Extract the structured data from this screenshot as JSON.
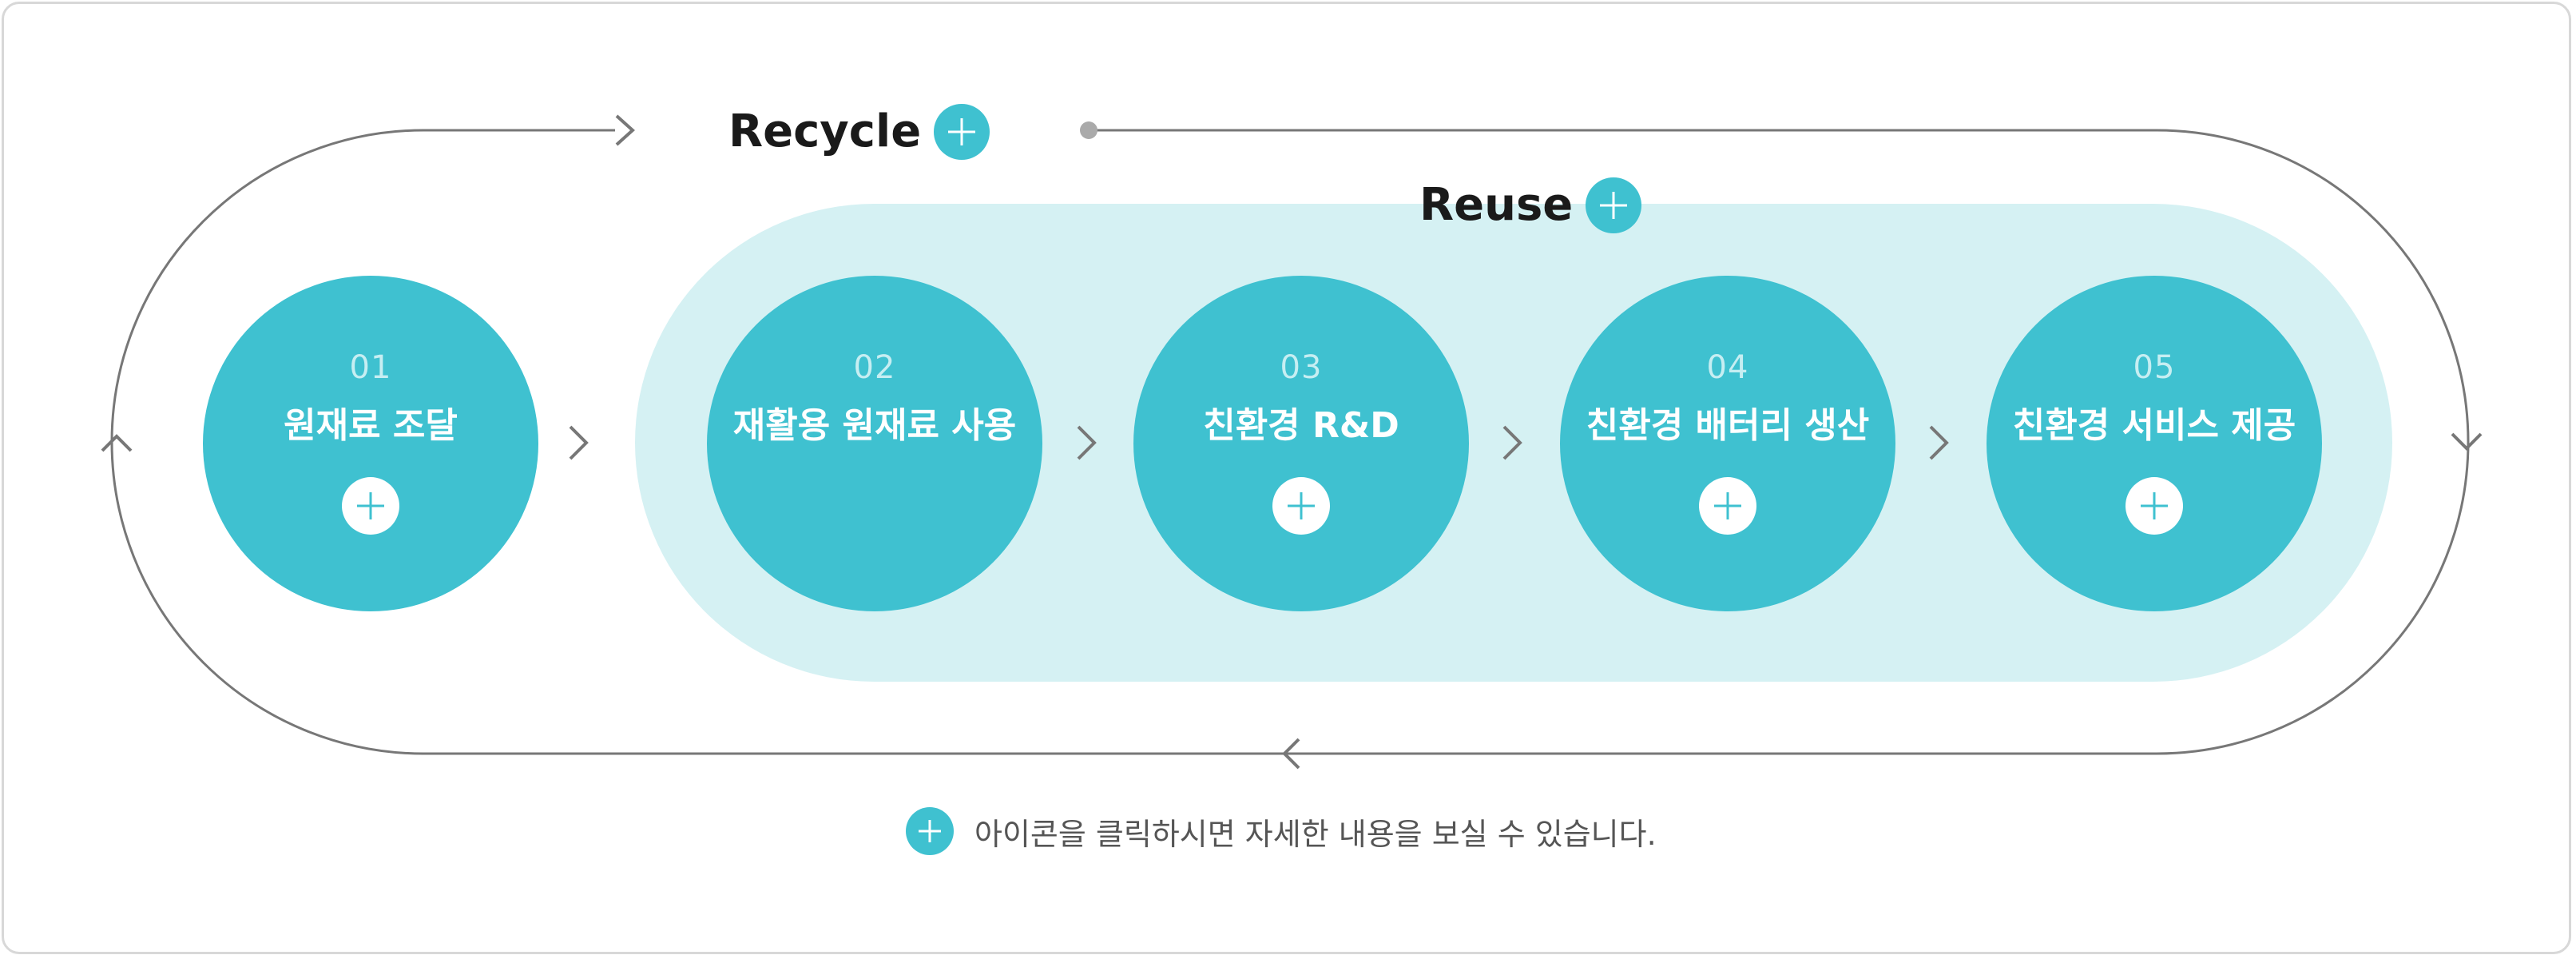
{
  "labels": {
    "recycle": "Recycle",
    "reuse": "Reuse"
  },
  "steps": [
    {
      "number": "01",
      "name": "원재료 조달"
    },
    {
      "number": "02",
      "name": "재활용 원재료 사용"
    },
    {
      "number": "03",
      "name": "친환경 R&D"
    },
    {
      "number": "04",
      "name": "친환경 배터리 생산"
    },
    {
      "number": "05",
      "name": "친환경 서비스 제공"
    }
  ],
  "note": "아이콘을 클릭하시면 자세한 내용을 보실 수 있습니다.",
  "colors": {
    "accent": "#3fc1d0",
    "reuse_background": "#d5f1f3",
    "loop_line": "#777777"
  },
  "icons": {
    "plus": "plus-icon",
    "chevron": "chevron-right-icon"
  }
}
